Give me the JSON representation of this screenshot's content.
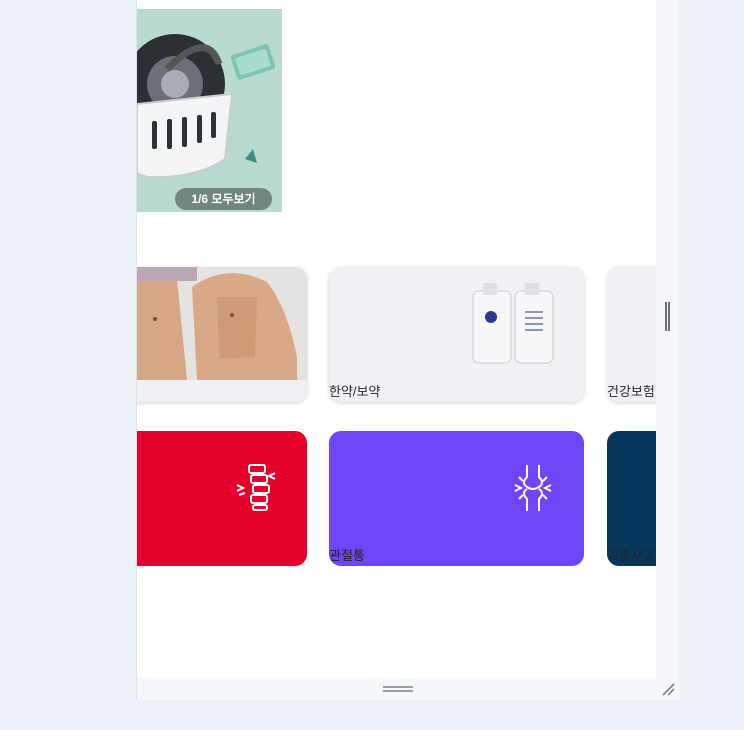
{
  "banner": {
    "counter": "1/6 모두보기"
  },
  "photo_cards": [
    {
      "label": ""
    },
    {
      "label": "한약/보약"
    },
    {
      "label": "건강보험"
    }
  ],
  "color_tiles": [
    {
      "label": "",
      "color": "#e5002b",
      "icon": "spine-icon"
    },
    {
      "label": "관절통",
      "color": "#6d47f5",
      "icon": "joint-icon"
    },
    {
      "label": "교통사고",
      "color": "#06355e",
      "icon": ""
    }
  ]
}
